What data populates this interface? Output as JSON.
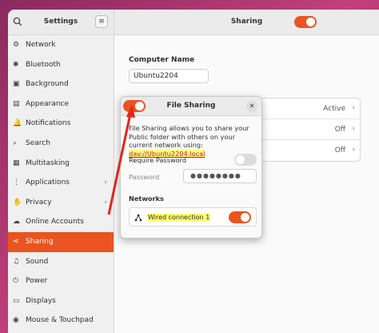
{
  "sidebar": {
    "title": "Settings",
    "menu_glyph": "≡",
    "items": [
      {
        "label": "Network",
        "icon": "network-icon",
        "glyph": "⚙"
      },
      {
        "label": "Bluetooth",
        "icon": "bluetooth-icon",
        "glyph": "✱"
      },
      {
        "label": "Background",
        "icon": "background-icon",
        "glyph": "▣"
      },
      {
        "label": "Appearance",
        "icon": "appearance-icon",
        "glyph": "▤"
      },
      {
        "label": "Notifications",
        "icon": "bell-icon",
        "glyph": "🔔"
      },
      {
        "label": "Search",
        "icon": "search-icon",
        "glyph": "⌕"
      },
      {
        "label": "Multitasking",
        "icon": "multitasking-icon",
        "glyph": "▦"
      },
      {
        "label": "Applications",
        "icon": "applications-icon",
        "glyph": "⋮",
        "chevron": "›"
      },
      {
        "label": "Privacy",
        "icon": "privacy-icon",
        "glyph": "✋",
        "chevron": "›"
      },
      {
        "label": "Online Accounts",
        "icon": "cloud-icon",
        "glyph": "☁"
      },
      {
        "label": "Sharing",
        "icon": "share-icon",
        "glyph": "⋖",
        "active": true
      },
      {
        "label": "Sound",
        "icon": "music-icon",
        "glyph": "♫"
      },
      {
        "label": "Power",
        "icon": "power-icon",
        "glyph": "⏻"
      },
      {
        "label": "Displays",
        "icon": "display-icon",
        "glyph": "▭"
      },
      {
        "label": "Mouse & Touchpad",
        "icon": "mouse-icon",
        "glyph": "◉"
      }
    ]
  },
  "header": {
    "title": "Sharing",
    "toggle_on": true
  },
  "computer_name": {
    "label": "Computer Name",
    "value": "Ubuntu2204"
  },
  "sharing_list": [
    {
      "value": "Active",
      "chevron": "›"
    },
    {
      "value": "Off",
      "chevron": "›"
    },
    {
      "value": "Off",
      "chevron": "›"
    }
  ],
  "dialog": {
    "title": "File Sharing",
    "close_glyph": "✕",
    "toggle_on": true,
    "description": "File Sharing allows you to share your Public folder with others on your current network using: ",
    "link": "dav://Ubuntu2204.local",
    "require_password_label": "Require Password",
    "require_password_on": false,
    "password_label": "Password",
    "password_value": "●●●●●●●●",
    "networks_label": "Networks",
    "network_name": "Wired connection 1",
    "network_on": true
  },
  "colors": {
    "accent": "#e95420",
    "annotation_arrow": "#e2271c",
    "highlight": "#ffff66"
  }
}
